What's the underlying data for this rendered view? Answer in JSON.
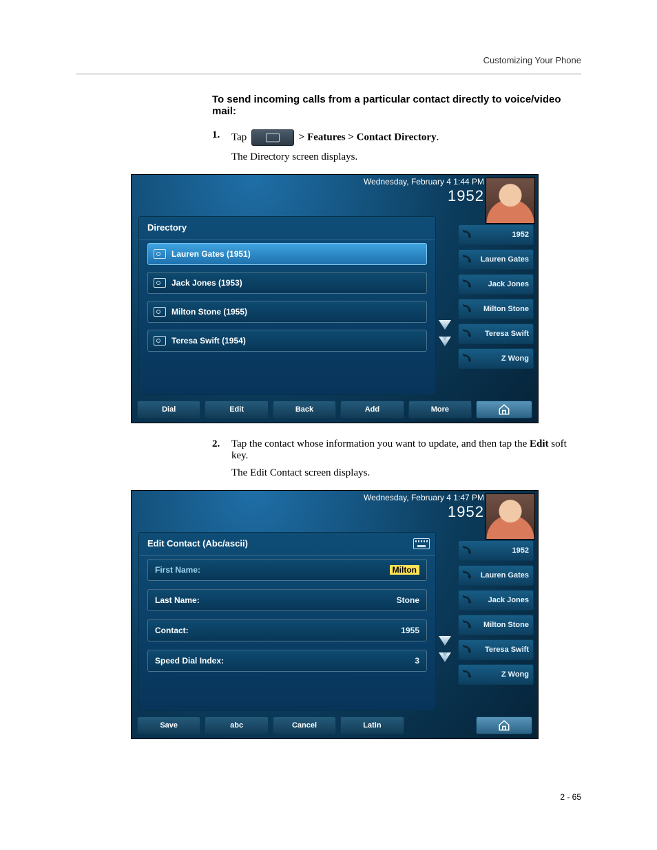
{
  "header": {
    "running": "Customizing Your Phone"
  },
  "title": "To send incoming calls from a particular contact directly to voice/video mail:",
  "step1": {
    "num": "1.",
    "verb": "Tap",
    "nav": "> Features > Contact Directory",
    "period": ".",
    "result": "The Directory screen displays."
  },
  "step2": {
    "num": "2.",
    "text_a": "Tap the contact whose information you want to update, and then tap the ",
    "bold": "Edit",
    "text_b": " soft key.",
    "result": "The Edit Contact screen displays."
  },
  "shot1": {
    "datetime": "Wednesday, February 4  1:44 PM",
    "ext": "1952",
    "title": "Directory",
    "entries": [
      "Lauren Gates (1951)",
      "Jack Jones (1953)",
      "Milton Stone (1955)",
      "Teresa Swift (1954)"
    ],
    "side": [
      "1952",
      "Lauren Gates",
      "Jack Jones",
      "Milton Stone",
      "Teresa Swift",
      "Z Wong"
    ],
    "footer": [
      "Dial",
      "Edit",
      "Back",
      "Add",
      "More"
    ]
  },
  "shot2": {
    "datetime": "Wednesday, February 4  1:47 PM",
    "ext": "1952",
    "title": "Edit Contact (Abc/ascii)",
    "fields": {
      "first_label": "First Name:",
      "first_val": "Milton",
      "last_label": "Last Name:",
      "last_val": "Stone",
      "contact_label": "Contact:",
      "contact_val": "1955",
      "sdi_label": "Speed Dial Index:",
      "sdi_val": "3"
    },
    "side": [
      "1952",
      "Lauren Gates",
      "Jack Jones",
      "Milton Stone",
      "Teresa Swift",
      "Z Wong"
    ],
    "footer": [
      "Save",
      "abc",
      "Cancel",
      "Latin"
    ]
  },
  "pagenum": "2 - 65"
}
